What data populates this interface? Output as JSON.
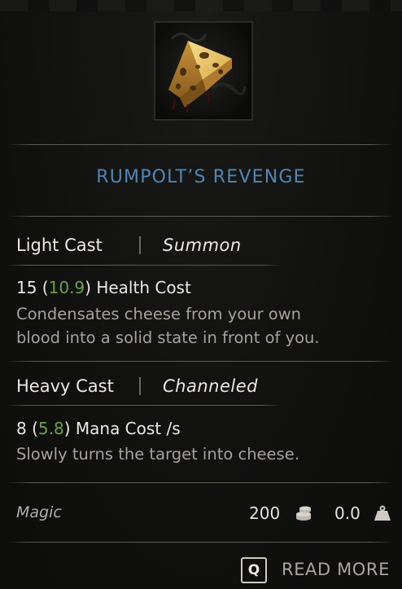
{
  "item": {
    "name": "RUMPOLT’S REVENGE",
    "icon": "cheese-wedge-icon"
  },
  "light_cast": {
    "label": "Light Cast",
    "type": "Summon",
    "cost_base": "15",
    "cost_open": " (",
    "cost_modified": "10.9",
    "cost_close": ") Health Cost",
    "desc_line1": "Condensates cheese from your own",
    "desc_line2": "blood into a solid state in front of you."
  },
  "heavy_cast": {
    "label": "Heavy Cast",
    "type": "Channeled",
    "cost_base": "8",
    "cost_open": " (",
    "cost_modified": "5.8",
    "cost_close": ") Mana Cost /s",
    "desc_line1": "Slowly turns the target into cheese."
  },
  "footer": {
    "category": "Magic",
    "gold_value": "200",
    "gold_icon": "coin-stack-icon",
    "weight_value": "0.0",
    "weight_icon": "weight-icon"
  },
  "read_more": {
    "key": "Q",
    "label": "READ MORE"
  },
  "colors": {
    "title": "#4f86b4",
    "modified_value": "#6fa049",
    "description": "#a5a29b",
    "background": "#0f0f0f"
  }
}
